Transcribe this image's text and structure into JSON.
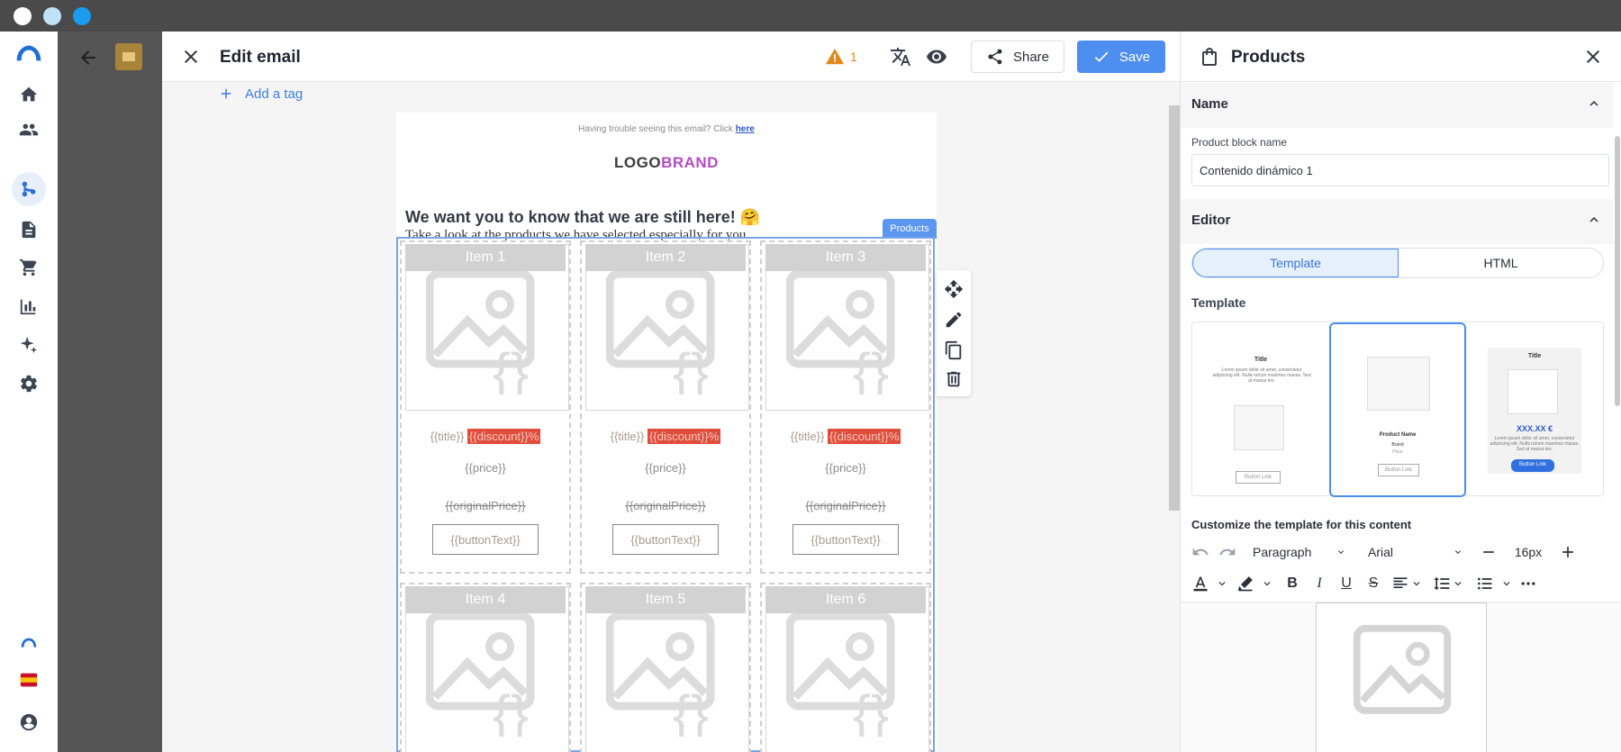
{
  "editor": {
    "title": "Edit email",
    "warning_count": "1",
    "share_label": "Share",
    "save_label": "Save",
    "add_tag_label": "Add a tag"
  },
  "email": {
    "trouble_text": "Having trouble seeing this email? Click ",
    "trouble_link": "here",
    "logo_part1": "LOGO",
    "logo_part2": "BRAND",
    "headline": "We want you to know that we are still here! 🤗",
    "subline": "Take a look at the products we have selected especially for you.",
    "products_tag": "Products",
    "items": [
      {
        "name": "Item 1",
        "title": "{{title}}",
        "discount": "{{discount}}%",
        "price": "{{price}}",
        "original_price": "{{originalPrice}}",
        "button": "{{buttonText}}"
      },
      {
        "name": "Item 2",
        "title": "{{title}}",
        "discount": "{{discount}}%",
        "price": "{{price}}",
        "original_price": "{{originalPrice}}",
        "button": "{{buttonText}}"
      },
      {
        "name": "Item 3",
        "title": "{{title}}",
        "discount": "{{discount}}%",
        "price": "{{price}}",
        "original_price": "{{originalPrice}}",
        "button": "{{buttonText}}"
      },
      {
        "name": "Item 4"
      },
      {
        "name": "Item 5"
      },
      {
        "name": "Item 6"
      }
    ]
  },
  "panel": {
    "title": "Products",
    "name_section": "Name",
    "block_name_label": "Product block name",
    "block_name_value": "Contenido dinámico 1",
    "editor_section": "Editor",
    "tab_template": "Template",
    "tab_html": "HTML",
    "template_label": "Template",
    "templates": [
      {
        "title": "Title",
        "text": "Lorem ipsum dolor sit amet, consectetur adipiscing elit. Nulla rutrum maximus massa. Sed at massa leo.",
        "button": "Button Link"
      },
      {
        "title": "Product Name",
        "brand": "Brand",
        "price": "Price",
        "button": "Button Link"
      },
      {
        "title": "Title",
        "price": "XXX.XX €",
        "text": "Lorem ipsum dolor sit amet, consectetur adipiscing elit. Nulla rutrum maximus massa. Sed at massa leo.",
        "button": "Button Link"
      }
    ],
    "customize_label": "Customize the template for this content",
    "block_type": "Paragraph",
    "font": "Arial",
    "font_size": "16px"
  },
  "colors": {
    "accent": "#4d8ef0",
    "warning": "#e08a1e",
    "discount": "#e04d3b",
    "brand_purple": "#b44cc3"
  }
}
